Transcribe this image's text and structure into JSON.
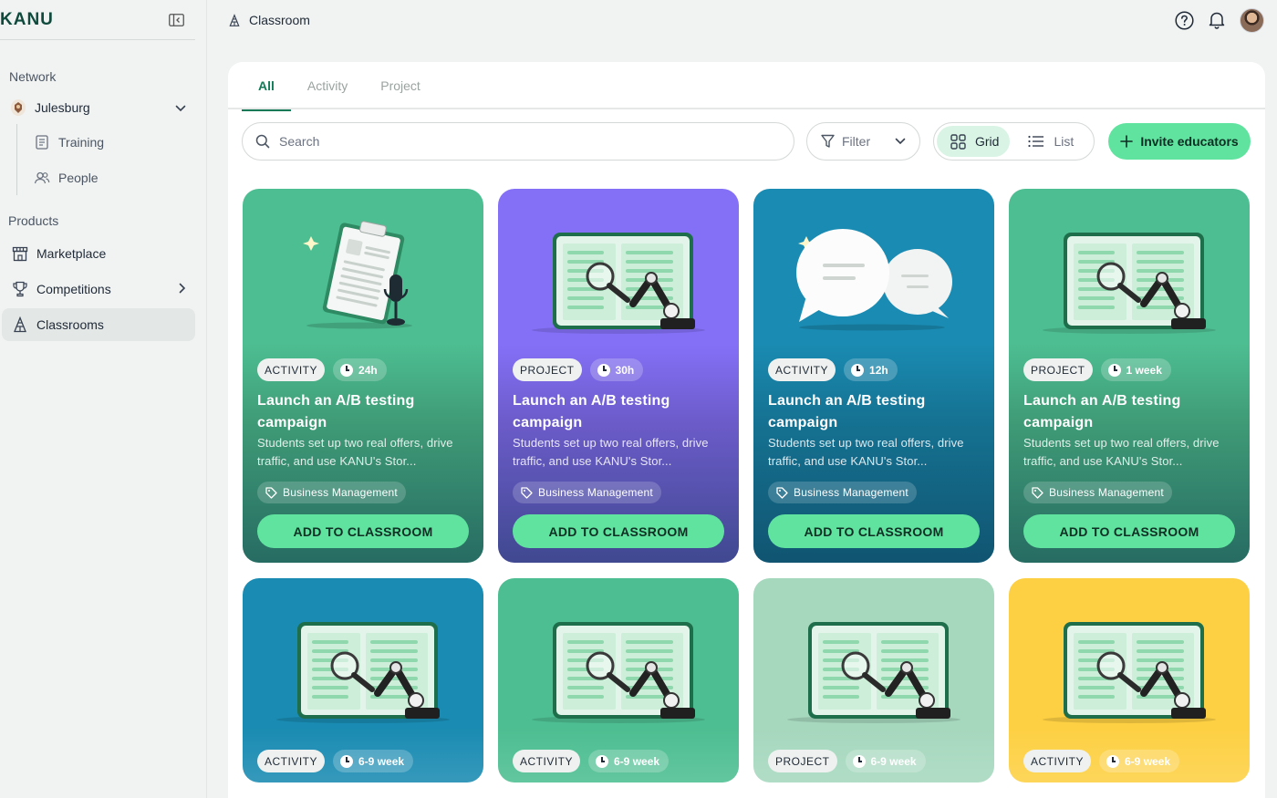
{
  "app": {
    "logo": "KANU"
  },
  "sidebar": {
    "network_label": "Network",
    "org": {
      "name": "Julesburg"
    },
    "org_items": [
      {
        "label": "Training",
        "icon": "document-icon"
      },
      {
        "label": "People",
        "icon": "people-icon"
      }
    ],
    "products_label": "Products",
    "items": [
      {
        "label": "Marketplace",
        "icon": "store-icon"
      },
      {
        "label": "Competitions",
        "icon": "trophy-icon"
      },
      {
        "label": "Classrooms",
        "icon": "classroom-icon",
        "active": true
      }
    ]
  },
  "header": {
    "title": "Classroom"
  },
  "tabs": [
    {
      "label": "All",
      "active": true
    },
    {
      "label": "Activity"
    },
    {
      "label": "Project"
    }
  ],
  "toolbar": {
    "search_placeholder": "Search",
    "filter_label": "Filter",
    "view_grid": "Grid",
    "view_list": "List",
    "invite_label": "Invite educators"
  },
  "cards": [
    {
      "type": "ACTIVITY",
      "duration": "24h",
      "title": "Launch an A/B testing campaign",
      "description": "Students set up two real offers, drive traffic, and use KANU's Stor...",
      "tag": "Business Management",
      "button": "ADD TO CLASSROOM",
      "color": "#4dbe91",
      "illustration": "clipboard-mic"
    },
    {
      "type": "PROJECT",
      "duration": "30h",
      "title": "Launch an A/B testing campaign",
      "description": "Students set up two real offers, drive traffic, and use KANU's Stor...",
      "tag": "Business Management",
      "button": "ADD TO CLASSROOM",
      "color": "#8470f7",
      "illustration": "laptop-robot"
    },
    {
      "type": "ACTIVITY",
      "duration": "12h",
      "title": "Launch an A/B testing campaign",
      "description": "Students set up two real offers, drive traffic, and use KANU's Stor...",
      "tag": "Business Management",
      "button": "ADD TO CLASSROOM",
      "color": "#1a8bb2",
      "illustration": "chat-bubbles"
    },
    {
      "type": "PROJECT",
      "duration": "1 week",
      "title": "Launch an A/B testing campaign",
      "description": "Students set up two real offers, drive traffic, and use KANU's Stor...",
      "tag": "Business Management",
      "button": "ADD TO CLASSROOM",
      "color": "#4dbe91",
      "illustration": "laptop-robot"
    },
    {
      "type": "ACTIVITY",
      "duration": "6-9 week",
      "color": "#1a8bb2",
      "illustration": "laptop-robot"
    },
    {
      "type": "ACTIVITY",
      "duration": "6-9 week",
      "color": "#4dbe91",
      "illustration": "laptop-robot"
    },
    {
      "type": "PROJECT",
      "duration": "6-9 week",
      "color": "#a6d8be",
      "illustration": "laptop-robot"
    },
    {
      "type": "ACTIVITY",
      "duration": "6-9 week",
      "color": "#fdd043",
      "illustration": "laptop-robot"
    }
  ]
}
